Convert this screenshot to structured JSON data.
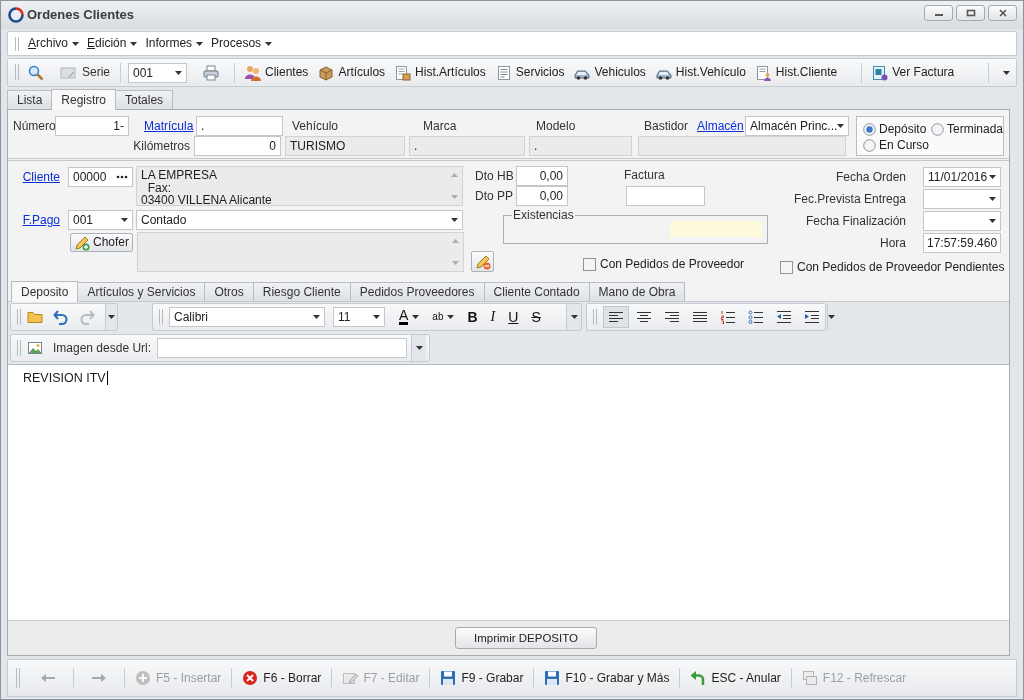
{
  "window": {
    "title": "Ordenes Clientes"
  },
  "menu": [
    {
      "label": "Archivo",
      "mnemonic": true
    },
    {
      "label": "Edición",
      "mnemonic": true
    },
    {
      "label": "Informes",
      "mnemonic": false
    },
    {
      "label": "Procesos",
      "mnemonic": false
    }
  ],
  "toolbar": {
    "serie_label": "Serie",
    "serie_value": "001",
    "button_groups": [
      {
        "buttons": [
          {
            "label": "Clientes"
          },
          {
            "label": "Artículos"
          },
          {
            "label": "Hist.Artículos"
          },
          {
            "label": "Servicios"
          },
          {
            "label": "Vehiculos"
          },
          {
            "label": "Hist.Vehículo"
          },
          {
            "label": "Hist.Cliente"
          }
        ]
      },
      {
        "buttons": [
          {
            "label": "Ver Factura"
          }
        ]
      }
    ]
  },
  "tabs": [
    {
      "label": "Lista",
      "selected": false
    },
    {
      "label": "Registro",
      "selected": true
    },
    {
      "label": "Totales",
      "selected": false
    }
  ],
  "header": {
    "numero": {
      "label": "Número",
      "value": "1-"
    },
    "matricula": {
      "label": "Matrícula",
      "value": "."
    },
    "vehiculo": {
      "label": "Vehículo",
      "value": "TURISMO"
    },
    "marca": {
      "label": "Marca",
      "value": "."
    },
    "modelo": {
      "label": "Modelo",
      "value": "."
    },
    "bastidor": {
      "label": "Bastidor"
    },
    "almacen": {
      "label": "Almacén",
      "value": "Almacén Princ..."
    },
    "kilometros": {
      "label": "Kilómetros",
      "value": "0"
    },
    "estado": [
      {
        "label": "Depósito",
        "selected": true
      },
      {
        "label": "Terminada",
        "selected": false
      },
      {
        "label": "En Curso",
        "selected": false
      }
    ]
  },
  "cliente": {
    "label": "Cliente",
    "code": "00000",
    "address": "LA EMPRESA\n  Fax:\n03400 VILLENA Alicante"
  },
  "forma_pago": {
    "label": "F.Pago",
    "code": "001",
    "value": "Contado"
  },
  "chofer": {
    "label": "Chofer"
  },
  "descuentos": [
    {
      "label": "Dto HB",
      "value": "0,00"
    },
    {
      "label": "Dto PP",
      "value": "0,00"
    }
  ],
  "factura": {
    "label": "Factura"
  },
  "existencias": {
    "label": "Existencias"
  },
  "fechas": [
    {
      "label": "Fecha Orden",
      "value": "11/01/2016",
      "kind": "dropdown"
    },
    {
      "label": "Fec.Prevista Entrega",
      "kind": "dropdown"
    },
    {
      "label": "Fecha Finalización",
      "kind": "dropdown"
    },
    {
      "label": "Hora",
      "value": "17:57:59.460",
      "kind": "text"
    }
  ],
  "opciones": [
    {
      "label": "Con Pedidos de Proveedor",
      "checked": false
    },
    {
      "label": "Con Pedidos de Proveedor Pendientes",
      "checked": false
    }
  ],
  "detail_tabs": [
    {
      "label": "Deposito",
      "selected": true
    },
    {
      "label": "Artículos y Servicios",
      "selected": false
    },
    {
      "label": "Otros",
      "selected": false
    },
    {
      "label": "Riesgo Cliente",
      "selected": false
    },
    {
      "label": "Pedidos Proveedores",
      "selected": false
    },
    {
      "label": "Cliente Contado",
      "selected": false
    },
    {
      "label": "Mano de Obra",
      "selected": false
    }
  ],
  "editor": {
    "font": "Calibri",
    "size": "11",
    "format_buttons": [
      {
        "label": "A",
        "kind": "font_color"
      },
      {
        "label": "ab",
        "kind": "highlight"
      },
      {
        "label": "B",
        "kind": "bold"
      },
      {
        "label": "I",
        "kind": "italic"
      },
      {
        "label": "U",
        "kind": "underline"
      },
      {
        "label": "S",
        "kind": "strike"
      }
    ],
    "paragraph_buttons": [
      {
        "selected": true
      },
      {
        "selected": false
      },
      {
        "selected": false
      },
      {
        "selected": false
      },
      {
        "selected": false
      },
      {
        "selected": false
      },
      {
        "selected": false
      },
      {
        "selected": false
      }
    ],
    "url_label": "Imagen desde Url:",
    "content": "REVISION ITV"
  },
  "print_button": "Imprimir DEPOSITO",
  "actions": [
    {
      "label": "F5 - Insertar",
      "disabled": true
    },
    {
      "label": "F6 - Borrar",
      "disabled": false
    },
    {
      "label": "F7 - Editar",
      "disabled": true
    },
    {
      "label": "F9 - Grabar",
      "disabled": false
    },
    {
      "label": "F10 - Grabar y Más",
      "disabled": false
    },
    {
      "label": "ESC - Anular",
      "disabled": false
    },
    {
      "label": "F12 - Refrescar",
      "disabled": true
    }
  ]
}
